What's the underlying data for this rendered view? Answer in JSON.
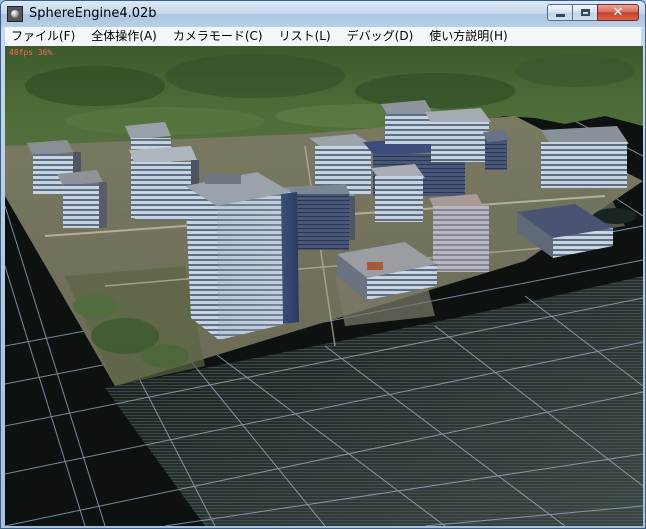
{
  "window": {
    "title": "SphereEngine4.02b"
  },
  "menu": {
    "items": [
      {
        "label": "ファイル(F)"
      },
      {
        "label": "全体操作(A)"
      },
      {
        "label": "カメラモード(C)"
      },
      {
        "label": "リスト(L)"
      },
      {
        "label": "デバッグ(D)"
      },
      {
        "label": "使い方説明(H)"
      }
    ]
  },
  "viewport": {
    "status": "40fps  36%"
  },
  "colors": {
    "titlebar": "#c2d7ec",
    "menubar": "#f5f6f7",
    "viewport_bg": "#0d1211",
    "grid": "#9fb3c8",
    "fps_text": "#ff6a5a"
  }
}
